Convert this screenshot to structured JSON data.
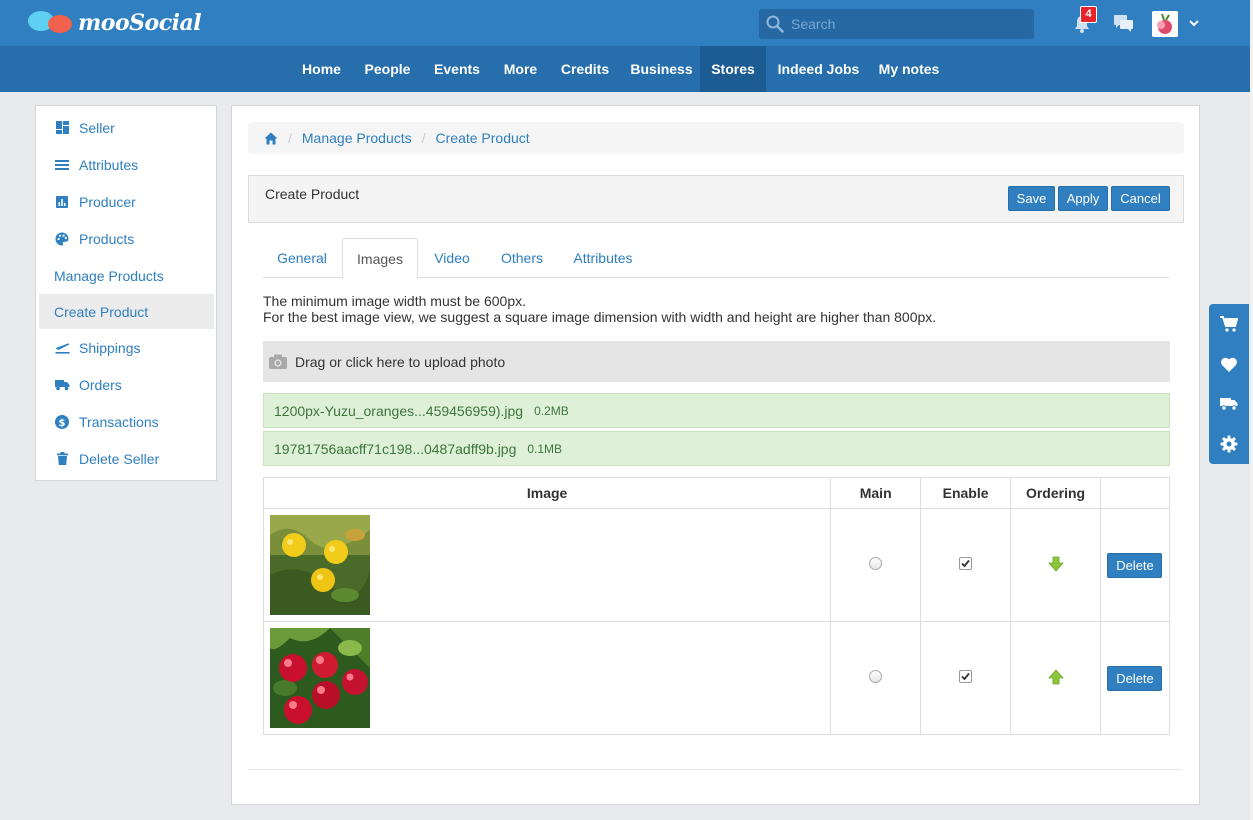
{
  "brand": {
    "name": "mooSocial"
  },
  "search": {
    "placeholder": "Search"
  },
  "notifications": {
    "count": "4"
  },
  "nav": {
    "items": [
      {
        "label": "Home"
      },
      {
        "label": "People"
      },
      {
        "label": "Events"
      },
      {
        "label": "More"
      },
      {
        "label": "Credits"
      },
      {
        "label": "Business"
      },
      {
        "label": "Stores"
      },
      {
        "label": "Indeed Jobs"
      },
      {
        "label": "My notes"
      }
    ],
    "active": "Stores"
  },
  "sidebar": {
    "items": [
      {
        "label": "Seller",
        "icon": "dashboard-icon"
      },
      {
        "label": "Attributes",
        "icon": "list-icon"
      },
      {
        "label": "Producer",
        "icon": "chart-icon"
      },
      {
        "label": "Products",
        "icon": "palette-icon"
      },
      {
        "label": "Manage Products",
        "icon": ""
      },
      {
        "label": "Create Product",
        "icon": ""
      },
      {
        "label": "Shippings",
        "icon": "plane-icon"
      },
      {
        "label": "Orders",
        "icon": "truck-icon"
      },
      {
        "label": "Transactions",
        "icon": "dollar-icon"
      },
      {
        "label": "Delete Seller",
        "icon": "trash-icon"
      }
    ],
    "active": "Create Product"
  },
  "breadcrumb": {
    "items": [
      "Manage Products",
      "Create Product"
    ]
  },
  "header": {
    "title": "Create Product",
    "save_label": "Save",
    "apply_label": "Apply",
    "cancel_label": "Cancel"
  },
  "tabs": {
    "items": [
      "General",
      "Images",
      "Video",
      "Others",
      "Attributes"
    ],
    "active": "Images"
  },
  "info": {
    "line1": "The minimum image width must be 600px.",
    "line2": "For the best image view, we suggest a square image dimension with width and height are higher than 800px."
  },
  "upload": {
    "label": "Drag or click here to upload photo"
  },
  "files": [
    {
      "name": "1200px-Yuzu_oranges...459456959).jpg",
      "size": "0.2MB"
    },
    {
      "name": "19781756aacff71c198...0487adff9b.jpg",
      "size": "0.1MB"
    }
  ],
  "table": {
    "headers": [
      "Image",
      "Main",
      "Enable",
      "Ordering",
      ""
    ],
    "rows": [
      {
        "image": "yuzu-oranges",
        "main": false,
        "enabled": true,
        "ordering": "down",
        "delete_label": "Delete"
      },
      {
        "image": "red-acerola",
        "main": false,
        "enabled": true,
        "ordering": "up",
        "delete_label": "Delete"
      }
    ]
  },
  "colors": {
    "topbar": "#2f7fc1",
    "navbar": "#266eac",
    "nav_active": "#1d5b93",
    "link": "#2f7fc1",
    "success_bg": "#dff0d8",
    "success_text": "#3c763d",
    "arrow_green": "#8cc63e"
  }
}
